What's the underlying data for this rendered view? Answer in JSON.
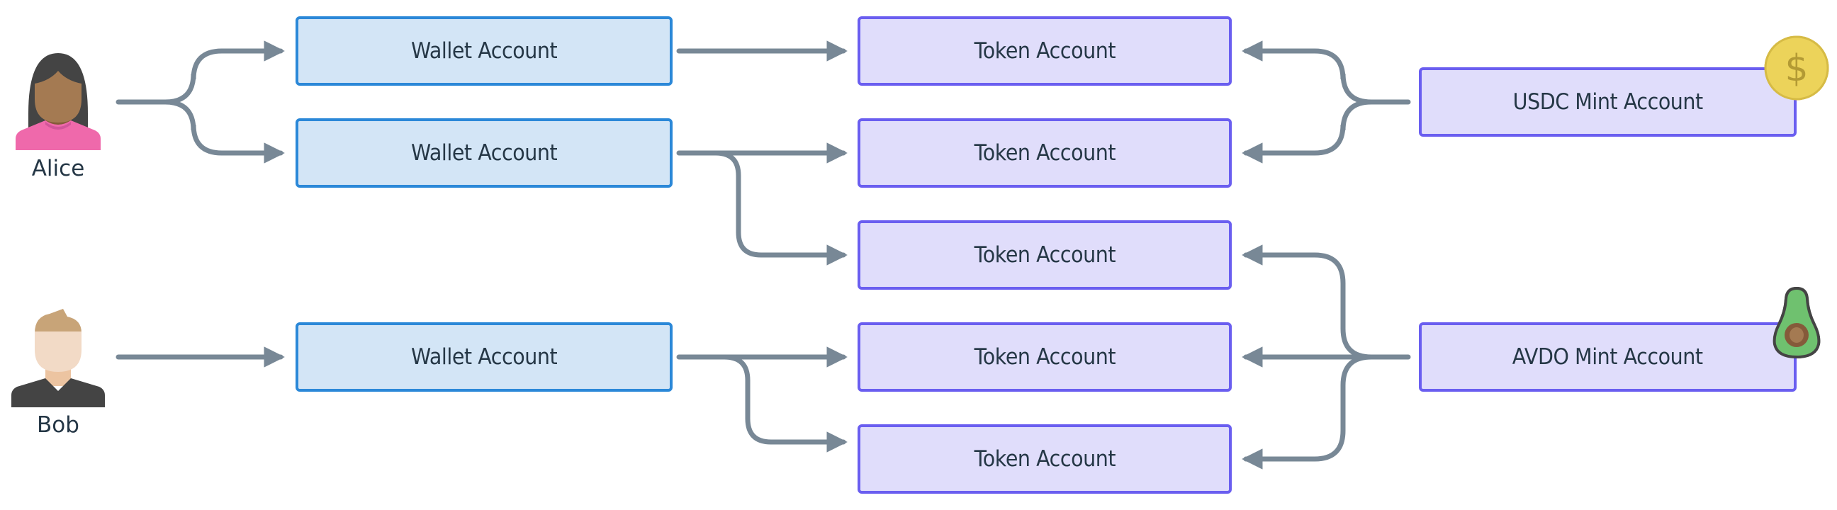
{
  "diagram": {
    "actors": [
      {
        "id": "alice",
        "label": "Alice",
        "icon": "person-female-icon"
      },
      {
        "id": "bob",
        "label": "Bob",
        "icon": "person-male-icon"
      }
    ],
    "wallets": [
      {
        "id": "w1",
        "label": "Wallet Account",
        "owner": "alice"
      },
      {
        "id": "w2",
        "label": "Wallet Account",
        "owner": "alice"
      },
      {
        "id": "w3",
        "label": "Wallet Account",
        "owner": "bob"
      }
    ],
    "tokens": [
      {
        "id": "t1",
        "label": "Token Account",
        "wallet": "w1",
        "mint": "usdc"
      },
      {
        "id": "t2",
        "label": "Token Account",
        "wallet": "w2",
        "mint": "usdc"
      },
      {
        "id": "t3",
        "label": "Token Account",
        "wallet": "w2",
        "mint": "avdo"
      },
      {
        "id": "t4",
        "label": "Token Account",
        "wallet": "w3",
        "mint": "avdo"
      },
      {
        "id": "t5",
        "label": "Token Account",
        "wallet": "w3",
        "mint": "avdo"
      }
    ],
    "mints": [
      {
        "id": "usdc",
        "label": "USDC Mint Account",
        "icon": "dollar-coin-icon"
      },
      {
        "id": "avdo",
        "label": "AVDO Mint Account",
        "icon": "avocado-icon"
      }
    ],
    "edges": [
      {
        "from": "alice",
        "to": "w1"
      },
      {
        "from": "alice",
        "to": "w2"
      },
      {
        "from": "bob",
        "to": "w3"
      },
      {
        "from": "w1",
        "to": "t1"
      },
      {
        "from": "w2",
        "to": "t2"
      },
      {
        "from": "w2",
        "to": "t3"
      },
      {
        "from": "w3",
        "to": "t4"
      },
      {
        "from": "w3",
        "to": "t5"
      },
      {
        "from": "usdc",
        "to": "t1"
      },
      {
        "from": "usdc",
        "to": "t2"
      },
      {
        "from": "avdo",
        "to": "t3"
      },
      {
        "from": "avdo",
        "to": "t4"
      },
      {
        "from": "avdo",
        "to": "t5"
      }
    ],
    "colors": {
      "wallet_fill": "#d3e5f6",
      "wallet_border": "#2b88d8",
      "token_fill": "#e0ddfb",
      "token_border": "#6a5ef0",
      "edge": "#788896",
      "text": "#253746",
      "coin": "#ecd35a",
      "avocado": "#6fc16f"
    }
  }
}
